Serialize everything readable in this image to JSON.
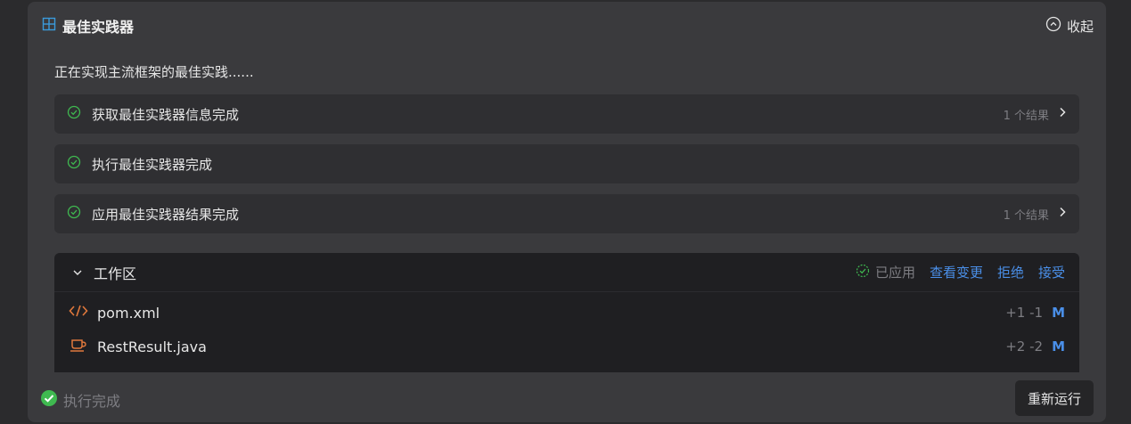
{
  "header": {
    "title": "最佳实践器",
    "collapse_label": "收起",
    "accent": "#3a9bdc"
  },
  "intro_text": "正在实现主流框架的最佳实践......",
  "steps": [
    {
      "label": "获取最佳实践器信息完成",
      "result": "1 个结果",
      "status": "success"
    },
    {
      "label": "执行最佳实践器完成",
      "result": "",
      "status": "success"
    },
    {
      "label": "应用最佳实践器结果完成",
      "result": "1 个结果",
      "status": "success"
    }
  ],
  "workspace": {
    "title": "工作区",
    "applied_label": "已应用",
    "view_changes": "查看变更",
    "reject": "拒绝",
    "accept": "接受",
    "files": [
      {
        "name": "pom.xml",
        "diff": "+1 -1",
        "state": "M",
        "icon": "xml-code-icon"
      },
      {
        "name": "RestResult.java",
        "diff": "+2 -2",
        "state": "M",
        "icon": "java-cup-icon"
      }
    ]
  },
  "footer": {
    "status_text": "执行完成",
    "rerun_label": "重新运行"
  },
  "colors": {
    "success": "#3fb950",
    "link": "#4a8fe8",
    "file_icon": "#e0783c"
  }
}
